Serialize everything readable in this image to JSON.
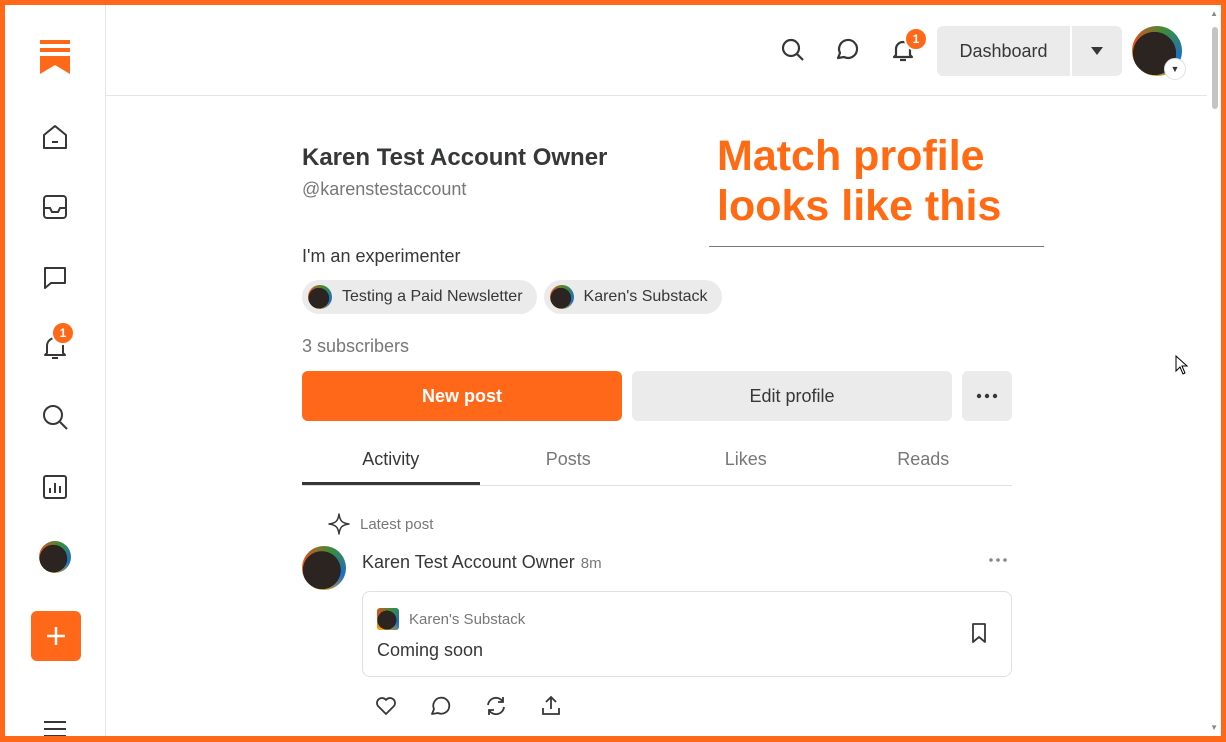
{
  "colors": {
    "accent": "#ff6719",
    "text": "#363737",
    "muted": "#777777",
    "chip_bg": "#ebebeb"
  },
  "sidebar": {
    "logo_icon": "substack-logo-icon",
    "items": [
      {
        "name": "home",
        "icon": "home-icon"
      },
      {
        "name": "inbox",
        "icon": "inbox-icon"
      },
      {
        "name": "chat",
        "icon": "chat-icon"
      },
      {
        "name": "notifications",
        "icon": "bell-icon",
        "badge": "1"
      },
      {
        "name": "search",
        "icon": "search-icon"
      },
      {
        "name": "dashboard",
        "icon": "stats-icon"
      },
      {
        "name": "profile",
        "icon": "avatar"
      }
    ],
    "new_button_icon": "plus-icon",
    "menu_icon": "hamburger-icon"
  },
  "topbar": {
    "notification_badge": "1",
    "dashboard_label": "Dashboard"
  },
  "profile": {
    "name": "Karen Test Account Owner",
    "handle": "@karenstestaccount",
    "bio": "I'm an experimenter",
    "publications": [
      "Testing a Paid Newsletter",
      "Karen's Substack"
    ],
    "subscribers": "3 subscribers",
    "new_post_label": "New post",
    "edit_profile_label": "Edit profile"
  },
  "tabs": [
    "Activity",
    "Posts",
    "Likes",
    "Reads"
  ],
  "feed": {
    "latest_label": "Latest post",
    "author": "Karen Test Account Owner",
    "time": "8m",
    "publication": "Karen's Substack",
    "post_title": "Coming soon"
  },
  "callout": {
    "text": "Match profile\nlooks like this"
  }
}
